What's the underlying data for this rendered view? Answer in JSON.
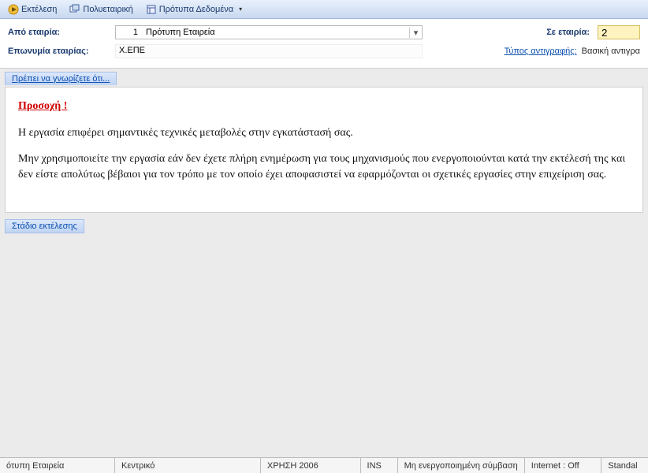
{
  "toolbar": {
    "items": [
      {
        "label": "Εκτέλεση",
        "icon": "play"
      },
      {
        "label": "Πολυεταιρική",
        "icon": "windows"
      },
      {
        "label": "Πρότυπα Δεδομένα",
        "icon": "template"
      }
    ]
  },
  "form": {
    "from_label": "Από εταιρία:",
    "from_num": "1",
    "from_name": "Πρότυπη Εταιρεία",
    "to_label": "Σε εταιρία:",
    "to_value": "2",
    "name_label": "Επωνυμία εταιρίας:",
    "name_value": "Χ.ΕΠΕ",
    "copytype_label": "Τύπος αντιγραφής:",
    "copytype_value": "Βασική αντιγρα"
  },
  "info_header": "Πρέπει να γνωρίζετε ότι...",
  "warning": {
    "title": "Προσοχή !",
    "p1": "Η εργασία επιφέρει σημαντικές τεχνικές μεταβολές στην εγκατάστασή σας.",
    "p2": "Μην χρησιμοποιείτε την εργασία εάν δεν έχετε πλήρη ενημέρωση για τους μηχανισμούς που ενεργοποιούνται κατά την εκτέλεσή της και δεν είστε απολύτως βέβαιοι για τον τρόπο με τον οποίο έχει αποφασιστεί να εφαρμόζονται οι σχετικές εργασίες στην επιχείριση σας."
  },
  "stage_header": "Στάδιο εκτέλεσης",
  "statusbar": {
    "company": "ότυπη Εταιρεία",
    "branch": "Κεντρικό",
    "use": "ΧΡΗΣΗ 2006",
    "ins": "INS",
    "subscription": "Μη ενεργοποιημένη σύμβαση",
    "internet": "Internet : Off",
    "mode": "Standal"
  }
}
